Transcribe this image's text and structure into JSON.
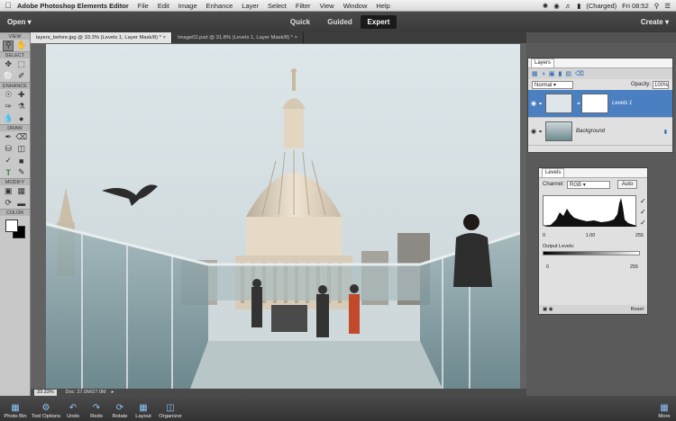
{
  "menubar": {
    "app_name": "Adobe Photoshop Elements Editor",
    "items": [
      "File",
      "Edit",
      "Image",
      "Enhance",
      "Layer",
      "Select",
      "Filter",
      "View",
      "Window",
      "Help"
    ],
    "battery": "(Charged)",
    "clock": "Fri 08:52"
  },
  "modebar": {
    "open_label": "Open",
    "modes": [
      "Quick",
      "Guided",
      "Expert"
    ],
    "active_mode": "Expert",
    "create_label": "Create"
  },
  "toolbox": {
    "sections": [
      "VIEW",
      "SELECT",
      "ENHANCE",
      "DRAW",
      "MODIFY",
      "COLOR"
    ]
  },
  "tabs": [
    {
      "label": "layers_before.jpg @ 33.3% (Levels 1, Layer Mask/8) *"
    },
    {
      "label": "Image02.psd @ 31.8% (Levels 1, Layer Mask/8) *"
    }
  ],
  "status": {
    "zoom": "33.33%",
    "doc": "Doc: 27.0M/27.0M"
  },
  "layers_panel": {
    "title": "Layers",
    "blend_mode": "Normal",
    "opacity_label": "Opacity:",
    "opacity_value": "100%",
    "layers": [
      {
        "name": "Levels 1",
        "selected": true
      },
      {
        "name": "Background",
        "selected": false
      }
    ]
  },
  "levels_panel": {
    "title": "Levels",
    "channel_label": "Channel:",
    "channel_value": "RGB",
    "auto_label": "Auto",
    "input_black": "0",
    "input_gamma": "1.00",
    "input_white": "255",
    "output_label": "Output Levels:",
    "output_black": "0",
    "output_white": "255",
    "reset_label": "Reset"
  },
  "bottombar": {
    "items": [
      {
        "label": "Photo Bin",
        "icon": "photo-bin-icon"
      },
      {
        "label": "Tool Options",
        "icon": "tool-options-icon"
      },
      {
        "label": "Undo",
        "icon": "undo-icon"
      },
      {
        "label": "Redo",
        "icon": "redo-icon"
      },
      {
        "label": "Rotate",
        "icon": "rotate-icon"
      },
      {
        "label": "Layout",
        "icon": "layout-icon"
      },
      {
        "label": "Organizer",
        "icon": "organizer-icon"
      }
    ],
    "more_label": "More"
  },
  "colors": {
    "accent": "#4a7fc1",
    "chrome_dark": "#3a3a3a",
    "panel_bg": "#e0e0e0"
  }
}
